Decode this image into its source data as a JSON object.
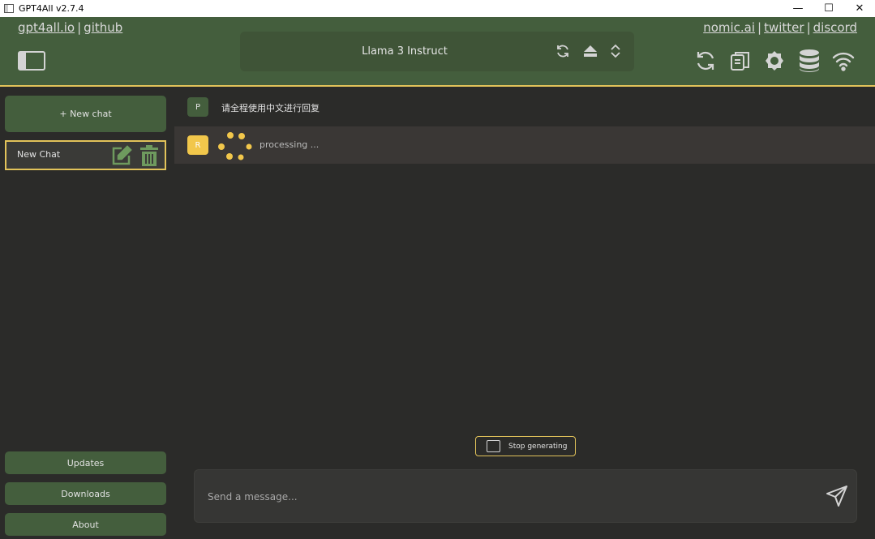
{
  "window": {
    "title": "GPT4All v2.7.4",
    "controls": {
      "minimize": "—",
      "maximize": "☐",
      "close": "✕"
    }
  },
  "header": {
    "links_left": [
      "gpt4all.io",
      "github"
    ],
    "links_right": [
      "nomic.ai",
      "twitter",
      "discord"
    ],
    "separator": "|",
    "model_name": "Llama 3 Instruct",
    "icons": [
      "sidebar-toggle-icon",
      "reload-icon",
      "eject-icon",
      "select-arrows-icon",
      "regenerate-icon",
      "copy-icon",
      "settings-icon",
      "database-icon",
      "network-icon"
    ]
  },
  "sidebar": {
    "new_chat_label": "+ New chat",
    "chats": [
      {
        "label": "New Chat"
      }
    ],
    "updates_label": "Updates",
    "downloads_label": "Downloads",
    "about_label": "About"
  },
  "conversation": {
    "messages": [
      {
        "avatar": "P",
        "text": "请全程使用中文进行回复"
      },
      {
        "avatar": "R",
        "text": "processing ..."
      }
    ],
    "stop_label": "Stop generating",
    "input_placeholder": "Send a message..."
  },
  "colors": {
    "header_bg": "#445e3d",
    "accent": "#e2c35a",
    "body_bg": "#2b2b29",
    "response_avatar": "#f2c74b"
  }
}
